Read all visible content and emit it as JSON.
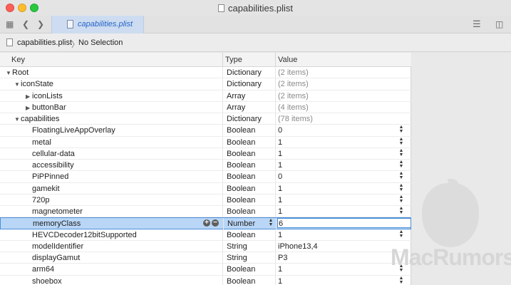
{
  "window": {
    "title": "capabilities.plist"
  },
  "toolbar": {
    "grid_icon": "grid-icon",
    "back_icon": "chevron-left-icon",
    "forward_icon": "chevron-right-icon",
    "tab_label": "capabilities.plist",
    "list_icon": "list-icon",
    "sidebar_icon": "sidebar-icon"
  },
  "pathbar": {
    "file": "capabilities.plist",
    "separator": "〉",
    "selection": "No Selection"
  },
  "table": {
    "columns": {
      "key": "Key",
      "type": "Type",
      "value": "Value"
    },
    "rows": [
      {
        "key": "Root",
        "type": "Dictionary",
        "value": "(2 items)",
        "level": 0,
        "disclosure": "open",
        "summary": true
      },
      {
        "key": "iconState",
        "type": "Dictionary",
        "value": "(2 items)",
        "level": 1,
        "disclosure": "open",
        "summary": true
      },
      {
        "key": "iconLists",
        "type": "Array",
        "value": "(2 items)",
        "level": 2,
        "disclosure": "closed",
        "summary": true
      },
      {
        "key": "buttonBar",
        "type": "Array",
        "value": "(4 items)",
        "level": 2,
        "disclosure": "closed",
        "summary": true
      },
      {
        "key": "capabilities",
        "type": "Dictionary",
        "value": "(78 items)",
        "level": 1,
        "disclosure": "open",
        "summary": true
      },
      {
        "key": "FloatingLiveAppOverlay",
        "type": "Boolean",
        "value": "0",
        "level": 2,
        "stepper": true
      },
      {
        "key": "metal",
        "type": "Boolean",
        "value": "1",
        "level": 2,
        "stepper": true
      },
      {
        "key": "cellular-data",
        "type": "Boolean",
        "value": "1",
        "level": 2,
        "stepper": true
      },
      {
        "key": "accessibility",
        "type": "Boolean",
        "value": "1",
        "level": 2,
        "stepper": true
      },
      {
        "key": "PiPPinned",
        "type": "Boolean",
        "value": "0",
        "level": 2,
        "stepper": true
      },
      {
        "key": "gamekit",
        "type": "Boolean",
        "value": "1",
        "level": 2,
        "stepper": true
      },
      {
        "key": "720p",
        "type": "Boolean",
        "value": "1",
        "level": 2,
        "stepper": true
      },
      {
        "key": "magnetometer",
        "type": "Boolean",
        "value": "1",
        "level": 2,
        "stepper": true
      },
      {
        "key": "memoryClass",
        "type": "Number",
        "value": "6",
        "level": 2,
        "selected": true
      },
      {
        "key": "HEVCDecoder12bitSupported",
        "type": "Boolean",
        "value": "1",
        "level": 2,
        "stepper": true
      },
      {
        "key": "modelIdentifier",
        "type": "String",
        "value": "iPhone13,4",
        "level": 2
      },
      {
        "key": "displayGamut",
        "type": "String",
        "value": "P3",
        "level": 2
      },
      {
        "key": "arm64",
        "type": "Boolean",
        "value": "1",
        "level": 2,
        "stepper": true
      },
      {
        "key": "shoebox",
        "type": "Boolean",
        "value": "1",
        "level": 2,
        "stepper": true
      }
    ]
  },
  "watermark": {
    "text": "MacRumors"
  },
  "colors": {
    "selection": "#b9d6f6",
    "accent": "#2463c9",
    "close": "#fc5f57",
    "minimize": "#fdbc2e",
    "maximize": "#28c840"
  }
}
